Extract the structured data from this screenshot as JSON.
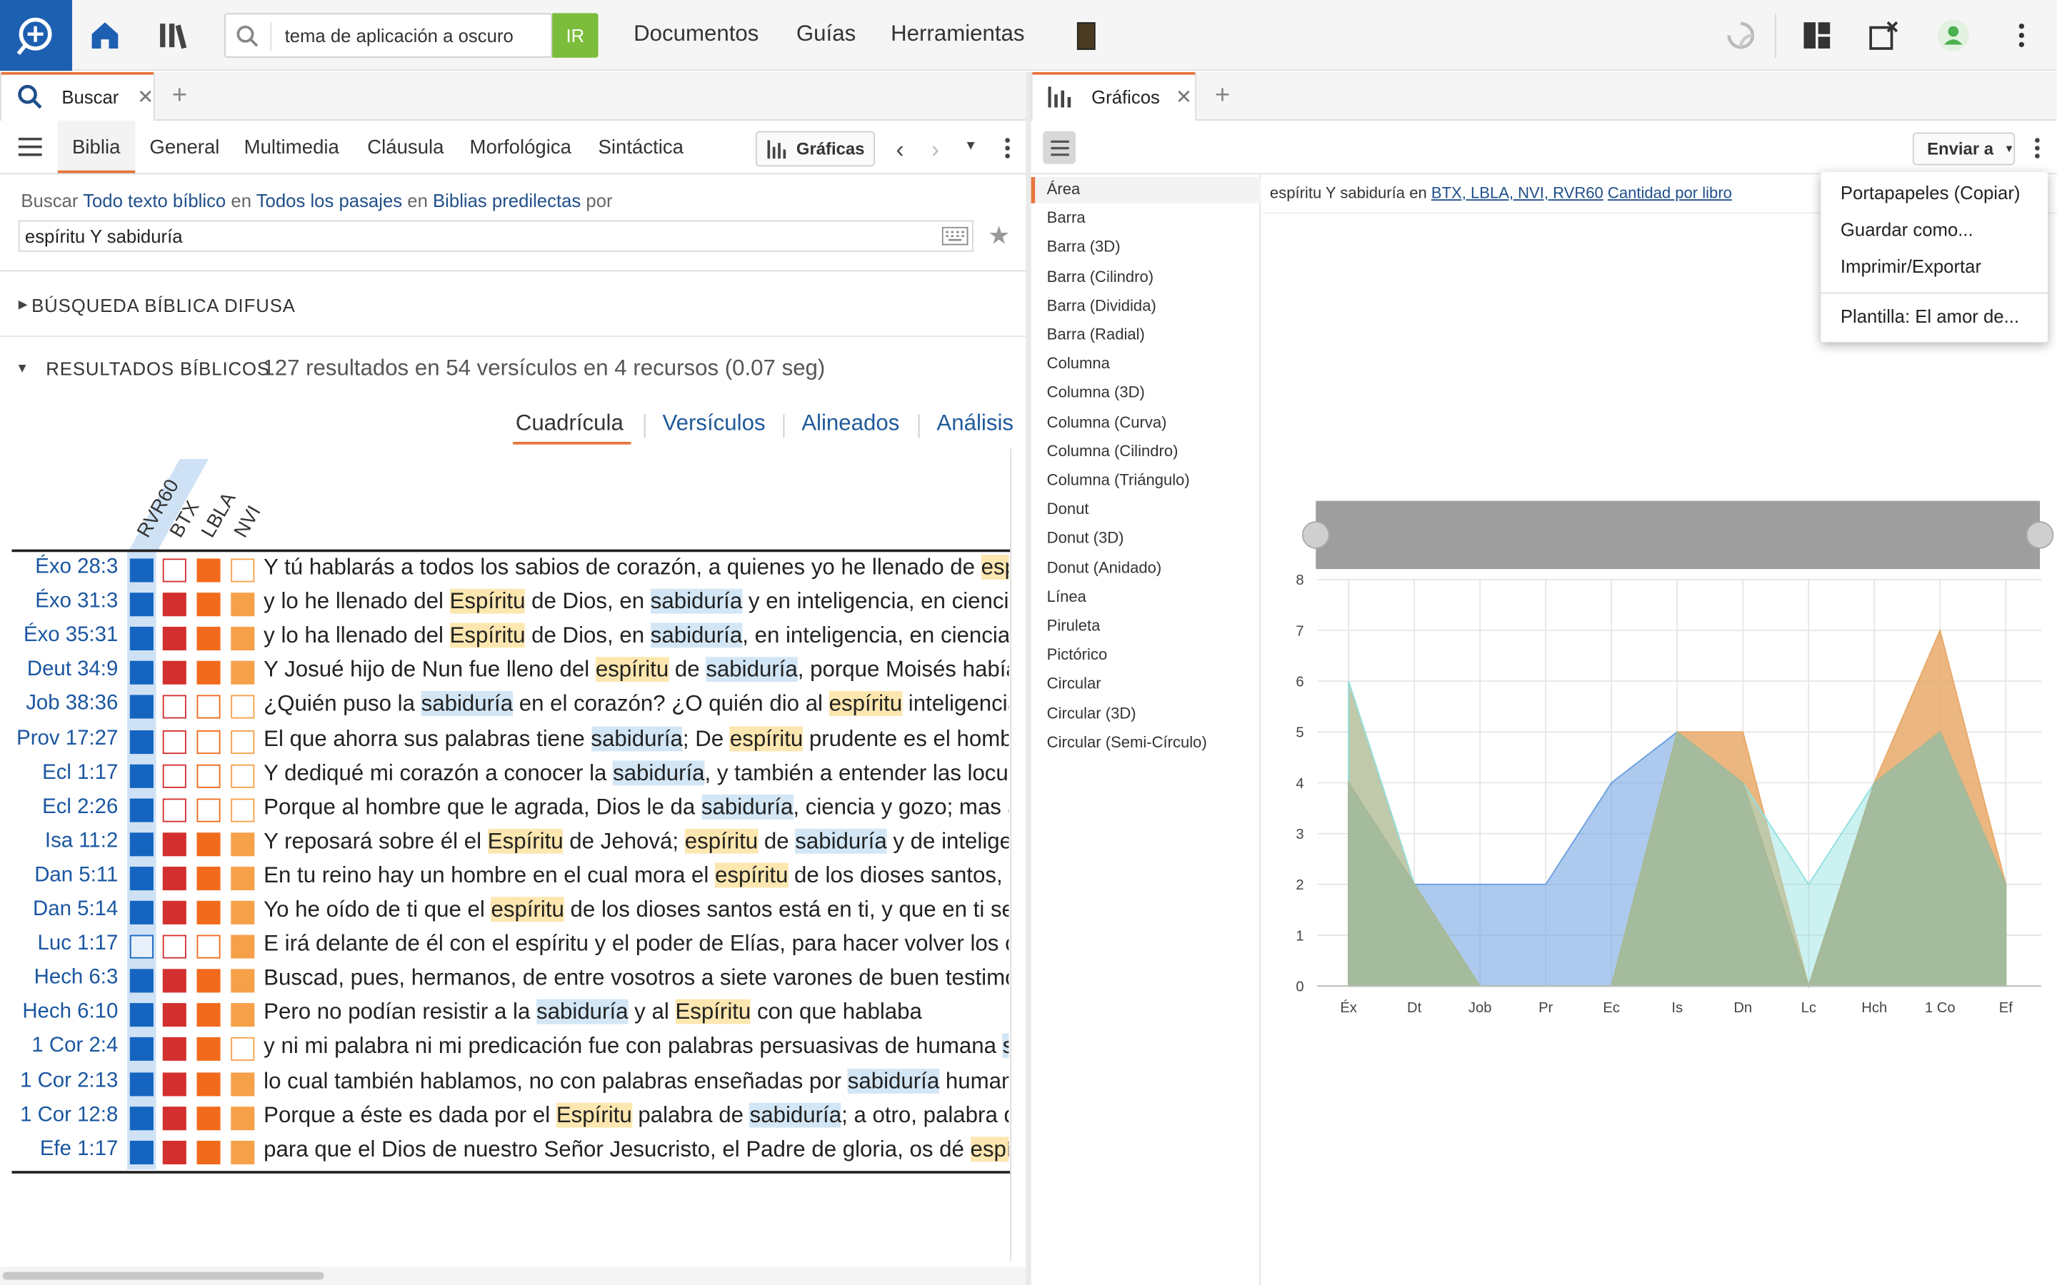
{
  "topbar": {
    "search_value": "tema de aplicación a oscuro",
    "go_label": "IR",
    "nav": [
      "Documentos",
      "Guías",
      "Herramientas"
    ]
  },
  "left_panel": {
    "tab_label": "Buscar",
    "subtabs": [
      "Biblia",
      "General",
      "Multimedia",
      "Cláusula",
      "Morfológica",
      "Sintáctica"
    ],
    "graficas_label": "Gráficas",
    "search_line": {
      "buscar": "Buscar",
      "scope1": "Todo texto bíblico",
      "en1": "en",
      "scope2": "Todos los pasajes",
      "en2": "en",
      "scope3": "Biblias predilectas",
      "por": "por"
    },
    "query": "espíritu Y sabiduría",
    "fuzzy_title": "BÚSQUEDA BÍBLICA DIFUSA",
    "results_title": "RESULTADOS BÍBLICOS",
    "results_summary": "127 resultados en 54 versículos en 4 recursos (0.07 seg)",
    "view_tabs": [
      "Cuadrícula",
      "Versículos",
      "Alineados",
      "Análisis"
    ],
    "columns": [
      "RVR60",
      "BTX",
      "LBLA",
      "NVI"
    ],
    "colors": {
      "rvr60": "#1565c0",
      "btx": "#d32f2f",
      "lbla": "#f26a1b",
      "nvi": "#f7a04a"
    },
    "rows": [
      {
        "ref": "Éxo 28:3",
        "cells": [
          1,
          0,
          1,
          0
        ],
        "segs": [
          [
            "Y tú hablarás a todos los sabios de corazón, a quienes yo he llenado de ",
            ""
          ],
          [
            "espíritu",
            "y"
          ]
        ]
      },
      {
        "ref": "Éxo 31:3",
        "cells": [
          1,
          1,
          1,
          1
        ],
        "segs": [
          [
            "y lo he llenado del ",
            ""
          ],
          [
            "Espíritu",
            "y"
          ],
          [
            " de Dios, en ",
            ""
          ],
          [
            "sabiduría",
            "b"
          ],
          [
            " y en inteligencia, en ciencia",
            ""
          ]
        ]
      },
      {
        "ref": "Éxo 35:31",
        "cells": [
          1,
          1,
          1,
          1
        ],
        "segs": [
          [
            "y lo ha llenado del ",
            ""
          ],
          [
            "Espíritu",
            "y"
          ],
          [
            " de Dios, en ",
            ""
          ],
          [
            "sabiduría",
            "b"
          ],
          [
            ", en inteligencia, en ciencia",
            ""
          ]
        ]
      },
      {
        "ref": "Deut 34:9",
        "cells": [
          1,
          1,
          1,
          1
        ],
        "segs": [
          [
            "Y Josué hijo de Nun fue lleno del ",
            ""
          ],
          [
            "espíritu",
            "y"
          ],
          [
            " de ",
            ""
          ],
          [
            "sabiduría",
            "b"
          ],
          [
            ", porque Moisés había",
            ""
          ]
        ]
      },
      {
        "ref": "Job 38:36",
        "cells": [
          1,
          0,
          0,
          0
        ],
        "segs": [
          [
            "¿Quién puso la ",
            ""
          ],
          [
            "sabiduría",
            "b"
          ],
          [
            " en el corazón? ¿O quién dio al ",
            ""
          ],
          [
            "espíritu",
            "y"
          ],
          [
            " inteligencia",
            ""
          ]
        ]
      },
      {
        "ref": "Prov 17:27",
        "cells": [
          1,
          0,
          0,
          0
        ],
        "segs": [
          [
            "El que ahorra sus palabras tiene ",
            ""
          ],
          [
            "sabiduría",
            "b"
          ],
          [
            "; De ",
            ""
          ],
          [
            "espíritu",
            "y"
          ],
          [
            " prudente es el hombre",
            ""
          ]
        ]
      },
      {
        "ref": "Ecl 1:17",
        "cells": [
          1,
          0,
          0,
          0
        ],
        "segs": [
          [
            "Y dediqué mi corazón a conocer la ",
            ""
          ],
          [
            "sabiduría",
            "b"
          ],
          [
            ", y también a entender las locuras",
            ""
          ]
        ]
      },
      {
        "ref": "Ecl 2:26",
        "cells": [
          1,
          0,
          0,
          0
        ],
        "segs": [
          [
            "Porque al hombre que le agrada, Dios le da ",
            ""
          ],
          [
            "sabiduría",
            "b"
          ],
          [
            ", ciencia y gozo; mas al",
            ""
          ]
        ]
      },
      {
        "ref": "Isa 11:2",
        "cells": [
          1,
          1,
          1,
          1
        ],
        "segs": [
          [
            "Y reposará sobre él el ",
            ""
          ],
          [
            "Espíritu",
            "y"
          ],
          [
            " de Jehová; ",
            ""
          ],
          [
            "espíritu",
            "y"
          ],
          [
            " de ",
            ""
          ],
          [
            "sabiduría",
            "b"
          ],
          [
            " y de inteligencia",
            ""
          ]
        ]
      },
      {
        "ref": "Dan 5:11",
        "cells": [
          1,
          1,
          1,
          1
        ],
        "segs": [
          [
            "En tu reino hay un hombre en el cual mora el ",
            ""
          ],
          [
            "espíritu",
            "y"
          ],
          [
            " de los dioses santos, y",
            ""
          ]
        ]
      },
      {
        "ref": "Dan 5:14",
        "cells": [
          1,
          1,
          1,
          1
        ],
        "segs": [
          [
            "Yo he oído de ti que el ",
            ""
          ],
          [
            "espíritu",
            "y"
          ],
          [
            " de los dioses santos está en ti, y que en ti se halló",
            ""
          ]
        ]
      },
      {
        "ref": "Luc 1:17",
        "cells": [
          2,
          0,
          0,
          1
        ],
        "segs": [
          [
            "E irá delante de él con el espíritu y el poder de Elías, para hacer volver los corazones",
            ""
          ]
        ]
      },
      {
        "ref": "Hech 6:3",
        "cells": [
          1,
          1,
          1,
          1
        ],
        "segs": [
          [
            "Buscad, pues, hermanos, de entre vosotros a siete varones de buen testimonio",
            ""
          ]
        ]
      },
      {
        "ref": "Hech 6:10",
        "cells": [
          1,
          1,
          1,
          1
        ],
        "segs": [
          [
            "Pero no podían resistir a la ",
            ""
          ],
          [
            "sabiduría",
            "b"
          ],
          [
            " y al ",
            ""
          ],
          [
            "Espíritu",
            "y"
          ],
          [
            " con que hablaba",
            ""
          ]
        ]
      },
      {
        "ref": "1 Cor 2:4",
        "cells": [
          1,
          1,
          1,
          0
        ],
        "segs": [
          [
            "y ni mi palabra ni mi predicación fue con palabras persuasivas de humana ",
            ""
          ],
          [
            "sabiduría",
            "b"
          ]
        ]
      },
      {
        "ref": "1 Cor 2:13",
        "cells": [
          1,
          1,
          1,
          1
        ],
        "segs": [
          [
            "lo cual también hablamos, no con palabras enseñadas por ",
            ""
          ],
          [
            "sabiduría",
            "b"
          ],
          [
            " humana",
            ""
          ]
        ]
      },
      {
        "ref": "1 Cor 12:8",
        "cells": [
          1,
          1,
          1,
          1
        ],
        "segs": [
          [
            "Porque a éste es dada por el ",
            ""
          ],
          [
            "Espíritu",
            "y"
          ],
          [
            " palabra de ",
            ""
          ],
          [
            "sabiduría",
            "b"
          ],
          [
            "; a otro, palabra de",
            ""
          ]
        ]
      },
      {
        "ref": "Efe 1:17",
        "cells": [
          1,
          1,
          1,
          1
        ],
        "segs": [
          [
            "para que el Dios de nuestro Señor Jesucristo, el Padre de gloria, os dé ",
            ""
          ],
          [
            "espíritu",
            "y"
          ]
        ]
      }
    ]
  },
  "right_panel": {
    "tab_label": "Gráficos",
    "send_label": "Enviar a",
    "chart_types": [
      "Área",
      "Barra",
      "Barra (3D)",
      "Barra (Cilindro)",
      "Barra (Dividida)",
      "Barra (Radial)",
      "Columna",
      "Columna (3D)",
      "Columna (Curva)",
      "Columna (Cilindro)",
      "Columna (Triángulo)",
      "Donut",
      "Donut (3D)",
      "Donut (Anidado)",
      "Línea",
      "Piruleta",
      "Pictórico",
      "Circular",
      "Circular (3D)",
      "Circular (Semi-Círculo)"
    ],
    "caption": {
      "query": "espíritu Y sabiduría",
      "en": "en",
      "resources": "BTX, LBLA, NVI, RVR60",
      "measure": "Cantidad por libro"
    },
    "menu": [
      "Portapapeles (Copiar)",
      "Guardar como...",
      "Imprimir/Exportar",
      "Plantilla: El amor de..."
    ]
  },
  "chart_data": {
    "type": "area",
    "categories": [
      "Éx",
      "Dt",
      "Job",
      "Pr",
      "Ec",
      "Is",
      "Dn",
      "Lc",
      "Hch",
      "1 Co",
      "Ef"
    ],
    "ylim": [
      0,
      8
    ],
    "yticks": [
      "0",
      "1",
      "2",
      "3",
      "4",
      "5",
      "6",
      "7",
      "8"
    ],
    "grid": true,
    "series": [
      {
        "color": "#e8a96a",
        "values": [
          6,
          2,
          0,
          0,
          0,
          5,
          5,
          0,
          4,
          7,
          2
        ]
      },
      {
        "color": "#6a9fe0",
        "values": [
          4,
          2,
          2,
          2,
          4,
          5,
          4,
          0,
          4,
          5,
          2
        ]
      },
      {
        "color": "#8fe0e0",
        "values": [
          6,
          2,
          0,
          0,
          0,
          5,
          4,
          2,
          4,
          5,
          2
        ]
      },
      {
        "color": "#a8b890",
        "values": [
          4,
          2,
          0,
          0,
          0,
          5,
          4,
          0,
          4,
          5,
          2
        ]
      }
    ]
  }
}
